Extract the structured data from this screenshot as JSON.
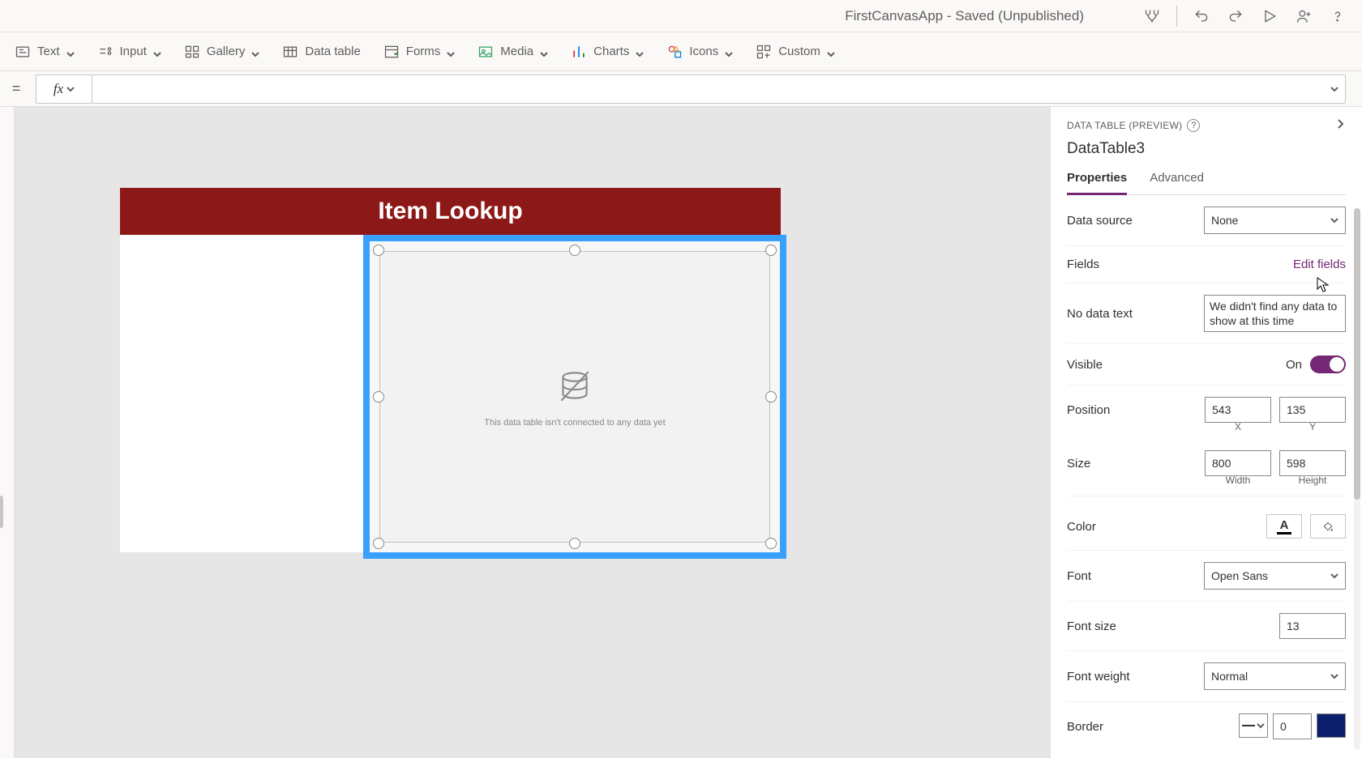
{
  "titlebar": {
    "title": "FirstCanvasApp - Saved (Unpublished)"
  },
  "ribbon": {
    "text": "Text",
    "input": "Input",
    "gallery": "Gallery",
    "datatable": "Data table",
    "forms": "Forms",
    "media": "Media",
    "charts": "Charts",
    "icons": "Icons",
    "custom": "Custom"
  },
  "formula": {
    "equals": "=",
    "fx": "fx",
    "value": ""
  },
  "canvas": {
    "header_title": "Item Lookup",
    "no_data_msg": "This data table isn't connected to any data yet"
  },
  "panel": {
    "type_label": "DATA TABLE (PREVIEW)",
    "control_name": "DataTable3",
    "tab_properties": "Properties",
    "tab_advanced": "Advanced",
    "rows": {
      "data_source": {
        "label": "Data source",
        "value": "None"
      },
      "fields": {
        "label": "Fields",
        "link": "Edit fields"
      },
      "no_data_text": {
        "label": "No data text",
        "value": "We didn't find any data to show at this time"
      },
      "visible": {
        "label": "Visible",
        "state": "On"
      },
      "position": {
        "label": "Position",
        "x": "543",
        "y": "135",
        "xlabel": "X",
        "ylabel": "Y"
      },
      "size": {
        "label": "Size",
        "w": "800",
        "h": "598",
        "wlabel": "Width",
        "hlabel": "Height"
      },
      "color": {
        "label": "Color",
        "glyph": "A"
      },
      "font": {
        "label": "Font",
        "value": "Open Sans"
      },
      "font_size": {
        "label": "Font size",
        "value": "13"
      },
      "font_weight": {
        "label": "Font weight",
        "value": "Normal"
      },
      "border": {
        "label": "Border",
        "width": "0",
        "color": "#0b1f6b"
      }
    }
  }
}
